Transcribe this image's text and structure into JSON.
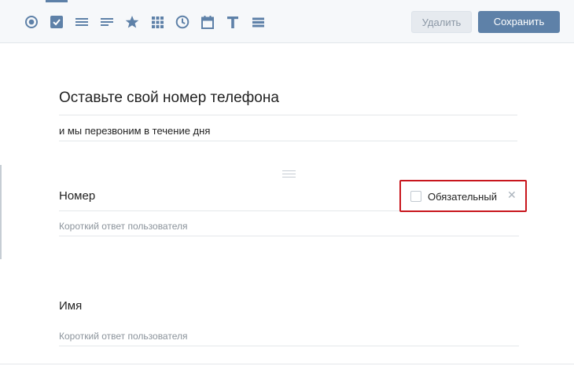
{
  "toolbar": {
    "tools": [
      {
        "icon": "radio-icon",
        "active": false
      },
      {
        "icon": "checkbox-icon",
        "active": true
      },
      {
        "icon": "lines-icon",
        "active": false
      },
      {
        "icon": "text-paragraph-icon",
        "active": false
      },
      {
        "icon": "star-icon",
        "active": false
      },
      {
        "icon": "grid-icon",
        "active": false
      },
      {
        "icon": "clock-icon",
        "active": false
      },
      {
        "icon": "calendar-icon",
        "active": false
      },
      {
        "icon": "text-t-icon",
        "active": false
      },
      {
        "icon": "list-icon",
        "active": false
      }
    ],
    "delete_label": "Удалить",
    "save_label": "Сохранить"
  },
  "form": {
    "title": "Оставьте свой номер телефона",
    "description": "и мы перезвоним в течение дня"
  },
  "questions": [
    {
      "title": "Номер",
      "placeholder": "Короткий ответ пользователя",
      "required_label": "Обязательный",
      "required_checked": false
    },
    {
      "title": "Имя",
      "placeholder": "Короткий ответ пользователя"
    }
  ],
  "colors": {
    "accent": "#5e81a8",
    "highlight_border": "#c8161d",
    "icon": "#5e81a8"
  }
}
